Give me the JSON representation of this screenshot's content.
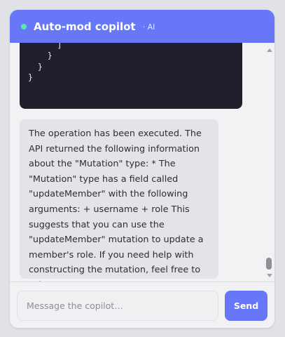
{
  "header": {
    "title": "Auto-mod copilot",
    "tag": "· AI"
  },
  "messages": {
    "code_snippet": "        }\n      ]\n    }\n  }\n}",
    "reply_text": "The operation has been executed. The API returned the following information about the \"Mutation\" type: * The \"Mutation\" type has a field called \"updateMember\" with the following arguments: + username + role This suggests that you can use the \"updateMember\" mutation to update a member's role. If you need help with constructing the mutation, feel free to ask!"
  },
  "composer": {
    "placeholder": "Message the copilot…",
    "send_label": "Send"
  },
  "colors": {
    "accent": "#6677f8",
    "status_online": "#5ce6a3",
    "code_background": "#1f202c",
    "page_background": "#e1e2e7"
  },
  "icons": {
    "status": "status-dot-icon",
    "scroll_up": "chevron-up-icon",
    "scroll_down": "chevron-down-icon"
  }
}
